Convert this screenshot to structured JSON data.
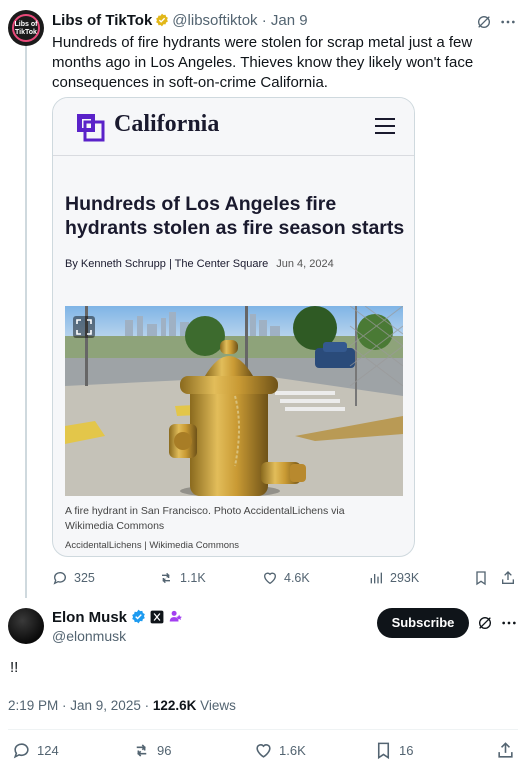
{
  "quoted_tweet": {
    "author_name": "Libs of TikTok",
    "handle": "@libsoftiktok",
    "date": "· Jan 9",
    "avatar_text": "Libs of TikTok",
    "text": "Hundreds of fire hydrants were stolen for scrap metal just a few months ago in Los Angeles. Thieves know they likely won't face consequences in soft-on-crime California.",
    "card": {
      "site_name": "California",
      "headline": "Hundreds of Los Angeles fire hydrants stolen as fire season starts",
      "byline": "By Kenneth Schrupp | The Center Square",
      "date": "Jun 4, 2024",
      "caption": "A fire hydrant in San Francisco. Photo AccidentalLichens via Wikimedia Commons",
      "credit": "AccidentalLichens | Wikimedia Commons"
    },
    "stats": {
      "replies": "325",
      "reposts": "1.1K",
      "likes": "4.6K",
      "views": "293K"
    }
  },
  "main_tweet": {
    "author_name": "Elon Musk",
    "handle": "@elonmusk",
    "subscribe_label": "Subscribe",
    "text": "!!",
    "time": "2:19 PM · Jan 9, 2025 · ",
    "views_count": "122.6K",
    "views_label": " Views",
    "stats": {
      "replies": "124",
      "reposts": "96",
      "likes": "1.6K",
      "bookmarks": "16"
    }
  },
  "colors": {
    "accent": "#1d9bf0",
    "gold": "#e2b719",
    "text_secondary": "#536471"
  }
}
